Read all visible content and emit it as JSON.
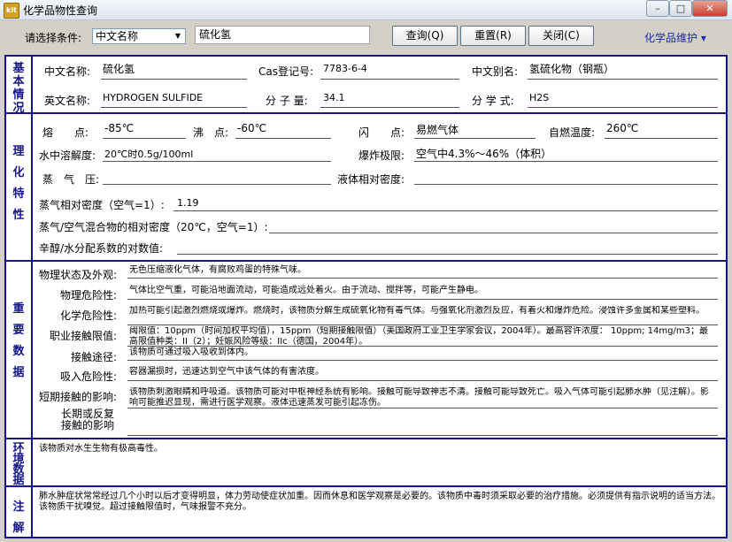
{
  "window": {
    "title": "化学品物性查询",
    "icon_text": "kit",
    "buttons": [
      "–",
      "□",
      "✕"
    ]
  },
  "toolbar": {
    "condition_label": "请选择条件:",
    "condition_value": "中文名称",
    "search_value": "硫化氢",
    "query_label": "查询(Q)",
    "reset_label": "重置(R)",
    "close_label": "关闭(C)",
    "maintenance_label": "化学品维护 ▾"
  },
  "sections": {
    "basic": "基本情况",
    "physchem": "理化特性",
    "important": "重要数据",
    "env": "环境数据",
    "notes": "注解"
  },
  "basic": {
    "cn_name_label": "中文名称:",
    "cn_name": "硫化氢",
    "cas_label": "Cas登记号:",
    "cas": "7783-6-4",
    "alias_label": "中文别名:",
    "alias": "氢硫化物（钢瓶）",
    "en_name_label": "英文名称:",
    "en_name": "HYDROGEN SULFIDE",
    "mw_label": "分 子 量:",
    "mw": "34.1",
    "formula_label": "分 学 式:",
    "formula": "H2S"
  },
  "physchem": {
    "melt_label": "熔　　点:",
    "melt": "-85℃",
    "boil_label": "沸　点:",
    "boil": "-60℃",
    "flash_label": "闪　　点:",
    "flash": "易燃气体",
    "autoign_label": "自燃温度:",
    "autoign": "260℃",
    "solubility_label": "水中溶解度:",
    "solubility": "20℃时0.5g/100ml",
    "explosive_label": "爆炸极限:",
    "explosive": "空气中4.3%～46%（体积）",
    "vapor_p_label": "蒸　气　压:",
    "vapor_p": "",
    "liquid_density_label": "液体相对密度:",
    "liquid_density": "",
    "vapor_density_label": "蒸气相对密度（空气=1）:",
    "vapor_density": "1.19",
    "mix_density_label": "蒸气/空气混合物的相对密度（20℃，空气=1）:",
    "mix_density": "",
    "octanol_label": "辛醇/水分配系数的对数值:",
    "octanol": ""
  },
  "important": {
    "physical_state_label": "物理状态及外观:",
    "physical_state": "无色压缩液化气体，有腐败鸡蛋的特殊气味。",
    "physical_hazard_label": "物理危险性:",
    "physical_hazard": "气体比空气重，可能沿地面流动，可能造成远处着火。由于流动、搅拌等，可能产生静电。",
    "chemical_hazard_label": "化学危险性:",
    "chemical_hazard": "加热可能引起激烈燃烧或爆炸。燃烧时，该物质分解生成硫氧化物有毒气体。与强氧化剂激烈反应，有着火和爆炸危险。浸蚀许多金属和某些塑料。",
    "exposure_limit_label": "职业接触限值:",
    "exposure_limit": "阈限值：10ppm（时间加权平均值），15ppm（短期接触限值）（美国政府工业卫生学家会议，2004年）。最高容许浓度： 10ppm; 14mg/m3；最高限值种类：II（2）；妊娠风险等级：IIc（德国，2004年）。",
    "route_label": "接触途径:",
    "route": "该物质可通过吸入吸收到体内。",
    "inhalation_label": "吸入危险性:",
    "inhalation": "容器漏损时，迅速达到空气中该气体的有害浓度。",
    "short_term_label": "短期接触的影响:",
    "short_term": "该物质刺激眼睛和呼吸道。该物质可能对中枢神经系统有影响。接触可能导致神志不清。接触可能导致死亡。吸入气体可能引起肺水肿（见注解）。影响可能推迟显现，需进行医学观察。液体迅速蒸发可能引起冻伤。",
    "long_term_label": "长期或反复接触的影响",
    "long_term": ""
  },
  "env": {
    "text": "该物质对水生生物有极高毒性。"
  },
  "notes": {
    "text": "肺水肿症状常常经过几个小时以后才变得明显，体力劳动使症状加重。因而休息和医学观察是必要的。该物质中毒时须采取必要的治疗措施。必须提供有指示说明的适当方法。该物质干扰嗅觉。超过接触限值时，气味报警不充分。"
  }
}
